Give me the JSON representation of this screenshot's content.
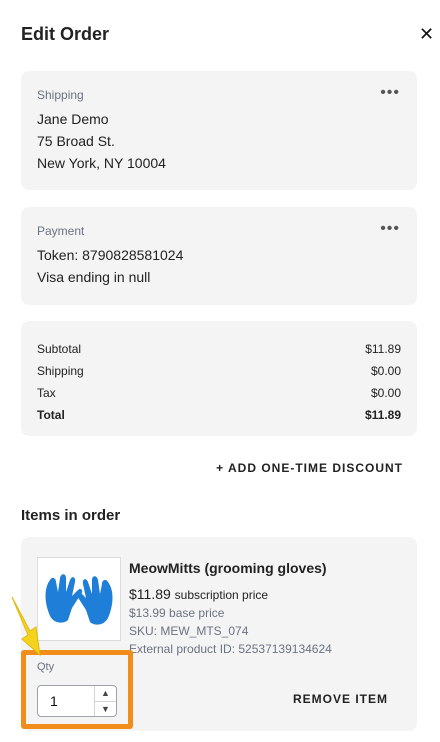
{
  "header": {
    "title": "Edit Order",
    "close_icon": "close-icon"
  },
  "shipping": {
    "label": "Shipping",
    "menu_icon": "more-dots-icon",
    "name": "Jane Demo",
    "street": "75 Broad St.",
    "city": "New York, NY 10004"
  },
  "payment": {
    "label": "Payment",
    "menu_icon": "more-dots-icon",
    "token": "Token: 8790828581024",
    "card": "Visa ending in null"
  },
  "totals": {
    "rows": [
      {
        "label": "Subtotal",
        "value": "$11.89"
      },
      {
        "label": "Shipping",
        "value": "$0.00"
      },
      {
        "label": "Tax",
        "value": "$0.00"
      },
      {
        "label": "Total",
        "value": "$11.89"
      }
    ]
  },
  "discount": {
    "label": "+ ADD ONE-TIME DISCOUNT"
  },
  "items": {
    "title": "Items in order",
    "item": {
      "name": "MeowMitts (grooming gloves)",
      "price": "$11.89",
      "price_note": "subscription price",
      "base_price": "$13.99 base price",
      "sku": "SKU: MEW_MTS_074",
      "external_id": "External product ID: 52537139134624",
      "qty_label": "Qty",
      "qty_value": "1",
      "remove_label": "REMOVE ITEM"
    }
  },
  "colors": {
    "highlight": "#f28c1a",
    "arrow": "#f5d31d",
    "glove": "#1f7fd8"
  }
}
